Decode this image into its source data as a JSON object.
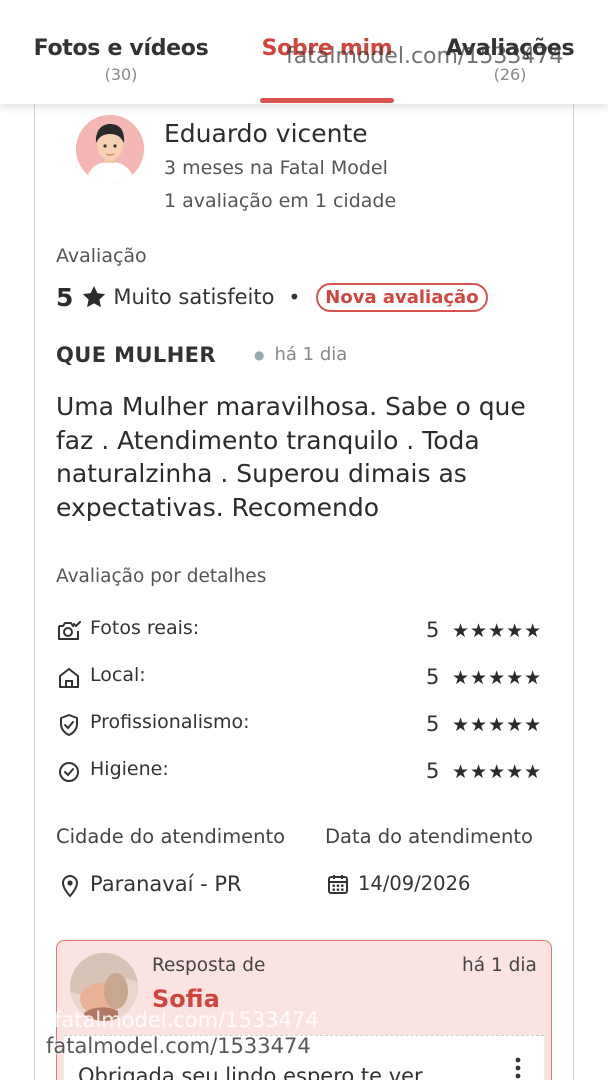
{
  "tabs": [
    {
      "label": "Fotos e vídeos",
      "count": "(30)"
    },
    {
      "label": "Sobre mim",
      "count": ""
    },
    {
      "label": "Avaliações",
      "count": "(26)"
    }
  ],
  "watermark": "fatalmodel.com/1533474",
  "reviewer": {
    "name": "Eduardo vicente",
    "since": "3 meses na Fatal Model",
    "reviews": "1 avaliação em 1 cidade"
  },
  "rating": {
    "title": "Avaliação",
    "score": "5",
    "label": "Muito satisfeito",
    "separator": "•",
    "badge": "Nova avaliação"
  },
  "review": {
    "title": "QUE MULHER",
    "time": "há 1 dia",
    "text": "Uma Mulher maravilhosa. Sabe o que faz . Atendimento tranquilo . Toda naturalzinha . Superou dimais as expectativas. Recomendo"
  },
  "details": {
    "title": "Avaliação por detalhes",
    "items": [
      {
        "label": "Fotos reais:",
        "score": "5",
        "stars": "★★★★★",
        "icon": "camera-check-icon"
      },
      {
        "label": "Local:",
        "score": "5",
        "stars": "★★★★★",
        "icon": "home-icon"
      },
      {
        "label": "Profissionalismo:",
        "score": "5",
        "stars": "★★★★★",
        "icon": "shield-check-icon"
      },
      {
        "label": "Higiene:",
        "score": "5",
        "stars": "★★★★★",
        "icon": "check-circle-icon"
      }
    ]
  },
  "meeting": {
    "city_title": "Cidade do atendimento",
    "city": "Paranavaí - PR",
    "date_title": "Data do atendimento",
    "date": "14/09/2026"
  },
  "reply": {
    "from_label": "Resposta de",
    "name": "Sofia",
    "time": "há 1 dia",
    "text": "Obrigada seu lindo espero te ver"
  },
  "colors": {
    "accent": "#d9534f",
    "reply_bg": "#fbe3e1",
    "text": "#2b2b2b"
  }
}
